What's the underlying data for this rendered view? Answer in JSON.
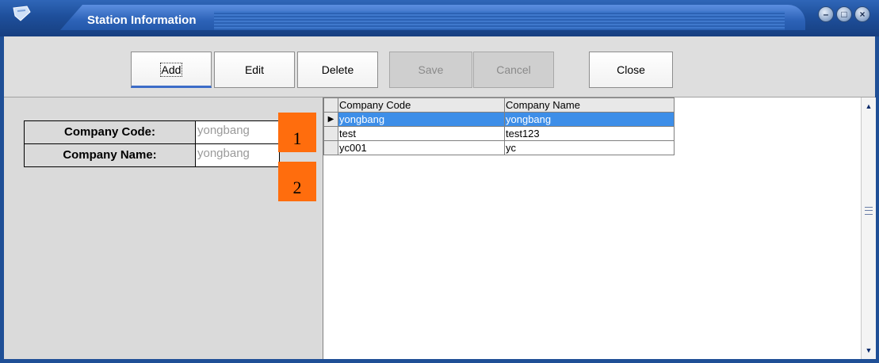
{
  "window": {
    "title": "Station Information",
    "controls": [
      "minimize-icon",
      "maximize-icon",
      "close-icon"
    ]
  },
  "toolbar": {
    "buttons": [
      {
        "label": "Add",
        "enabled": true,
        "focused": true
      },
      {
        "label": "Edit",
        "enabled": true
      },
      {
        "label": "Delete",
        "enabled": true
      },
      {
        "label": "Save",
        "enabled": false
      },
      {
        "label": "Cancel",
        "enabled": false
      },
      {
        "label": "Close",
        "enabled": true
      }
    ]
  },
  "form": {
    "company_code_label": "Company Code:",
    "company_code_value": "yongbang",
    "company_name_label": "Company Name:",
    "company_name_value": "yongbang"
  },
  "callouts": [
    "1",
    "2"
  ],
  "grid": {
    "columns": [
      "Company Code",
      "Company Name"
    ],
    "rows": [
      {
        "code": "yongbang",
        "name": "yongbang",
        "selected": true
      },
      {
        "code": "test",
        "name": "test123",
        "selected": false
      },
      {
        "code": "yc001",
        "name": "yc",
        "selected": false
      }
    ]
  },
  "colors": {
    "titlebar": "#1f4f96",
    "selection": "#3d8ee8",
    "callout": "#ff6d0d"
  }
}
